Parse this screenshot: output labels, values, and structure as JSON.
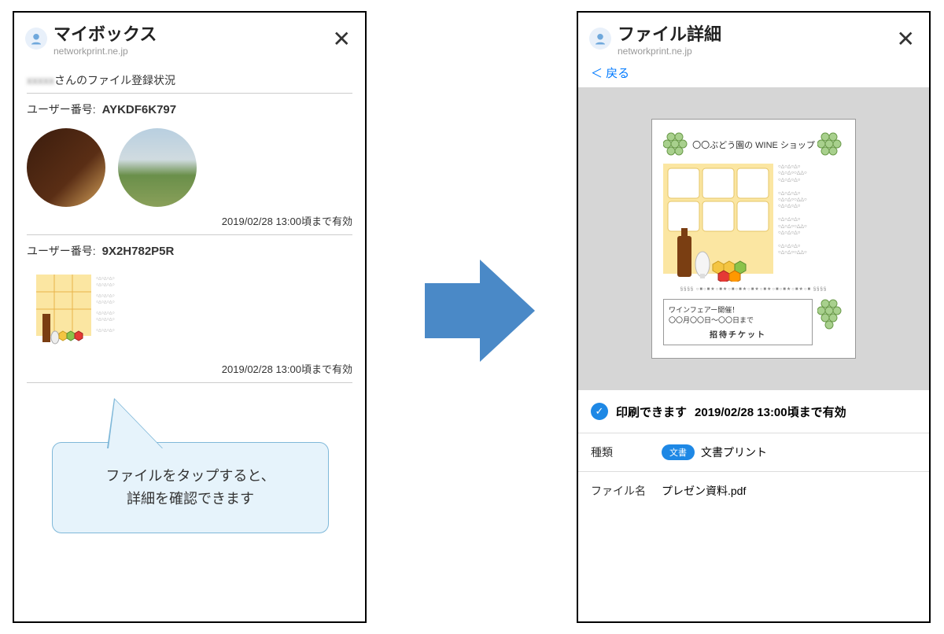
{
  "left": {
    "title": "マイボックス",
    "sub": "networkprint.ne.jp",
    "subheader": "さんのファイル登録状況",
    "userLabel": "ユーザー番号:",
    "user1": "AYKDF6K797",
    "user2": "9X2H782P5R",
    "valid": "2019/02/28 13:00頃まで有効",
    "callout1": "ファイルをタップすると、",
    "callout2": "詳細を確認できます"
  },
  "right": {
    "title": "ファイル詳細",
    "sub": "networkprint.ne.jp",
    "back": "＜ 戻る",
    "pageTitle": "〇〇ぶどう園の WINE ショップ",
    "fair": "ワインフェアー開催！",
    "fairDate": "〇〇月〇〇日～〇〇日まで",
    "ticket": "招待チケット",
    "statusOk": "印刷できます",
    "statusValid": "2019/02/28 13:00頃まで有効",
    "typeLabel": "種類",
    "typeBadge": "文書",
    "typeValue": "文書プリント",
    "fileLabel": "ファイル名",
    "fileValue": "プレゼン資料.pdf"
  }
}
